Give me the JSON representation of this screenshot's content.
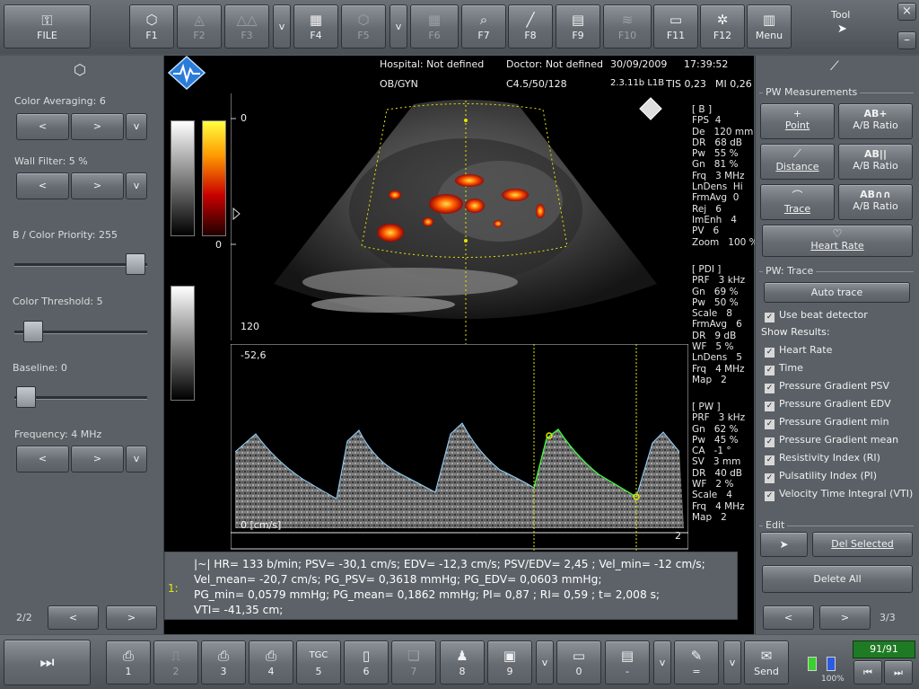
{
  "topbar": {
    "file_label": "FILE",
    "keys": [
      {
        "label": "F1",
        "icon": "⬡"
      },
      {
        "label": "F2",
        "icon": "◬"
      },
      {
        "label": "F3",
        "icon": "△△"
      },
      {
        "label": "v",
        "icon": ""
      },
      {
        "label": "F4",
        "icon": "▦"
      },
      {
        "label": "F5",
        "icon": "⬡"
      },
      {
        "label": "v",
        "icon": ""
      },
      {
        "label": "F6",
        "icon": "▦"
      },
      {
        "label": "F7",
        "icon": "⌕"
      },
      {
        "label": "F8",
        "icon": "╱"
      },
      {
        "label": "F9",
        "icon": "▤"
      },
      {
        "label": "F10",
        "icon": "≋"
      },
      {
        "label": "F11",
        "icon": "▭"
      },
      {
        "label": "F12",
        "icon": "✲"
      },
      {
        "label": "Menu",
        "icon": "▥"
      }
    ],
    "tool_label": "Tool",
    "close_label": "×",
    "minimize_label": "–"
  },
  "left_panel": {
    "color_averaging": "Color Averaging: 6",
    "wall_filter": "Wall Filter: 5 %",
    "color_priority": "B / Color Priority: 255",
    "color_threshold": "Color Threshold: 5",
    "baseline": "Baseline: 0",
    "frequency": "Frequency: 4 MHz",
    "left_arrow": "<",
    "right_arrow": ">",
    "dropdown": "v",
    "page": "2/2"
  },
  "header": {
    "hospital": "Hospital: Not defined",
    "doctor": "Doctor: Not defined",
    "date": "30/09/2009",
    "time": "17:39:52",
    "preset": "OB/GYN",
    "probe": "C4.5/50/128",
    "version": "2.3.11b L1B",
    "tis": "TIS 0,23",
    "mi": "MI 0,26"
  },
  "scale": {
    "top": "0",
    "bottom": "120",
    "color_zero": "0",
    "doppler_top": "-52,6",
    "doppler_zero": "0 [cm/s]",
    "doppler_right": "2"
  },
  "params": {
    "b_mode": "[ B ]\nFPS  4\nDe   120 mm\nDR   68 dB\nPw   55 %\nGn   81 %\nFrq   3 MHz\nLnDens  Hi\nFrmAvg  0\nRej   6\nImEnh   4\nPV   6\nZoom   100 %",
    "pdi": "[ PDI ]\nPRF   3 kHz\nGn   69 %\nPw   50 %\nScale   8\nFrmAvg   6\nDR   9 dB\nWF   5 %\nLnDens   5\nFrq   4 MHz\nMap   2",
    "pw": "[ PW ]\nPRF   3 kHz\nGn   62 %\nPw   45 %\nCA   -1 °\nSV   3 mm\nDR   40 dB\nWF   2 %\nScale   4\nFrq   4 MHz\nMap   2"
  },
  "results": {
    "index": "1:",
    "line1": "|~| HR= 133 b/min; PSV= -30,1 cm/s; EDV= -12,3 cm/s; PSV/EDV= 2,45 ; Vel_min= -12 cm/s;",
    "line2": "Vel_mean= -20,7 cm/s; PG_PSV= 0,3618 mmHg; PG_EDV= 0,0603 mmHg;",
    "line3": "PG_min= 0,0579 mmHg; PG_mean= 0,1862 mmHg; PI= 0,87 ; RI= 0,59 ; t= 2,008 s;",
    "line4": "VTI= -41,35 cm;"
  },
  "right_panel": {
    "pw_measurements_title": "PW Measurements",
    "point": "Point",
    "ab_ratio_1": "A/B Ratio",
    "distance": "Distance",
    "ab_ratio_2": "A/B Ratio",
    "trace": "Trace",
    "ab_ratio_3": "A/B Ratio",
    "heart_rate": "Heart Rate",
    "ab_icon": "AB",
    "pw_trace_title": "PW: Trace",
    "auto_trace": "Auto trace",
    "use_beat_detector": "Use beat detector",
    "show_results": "Show Results:",
    "checks": [
      "Heart Rate",
      "Time",
      "Pressure Gradient PSV",
      "Pressure Gradient EDV",
      "Pressure Gradient min",
      "Pressure Gradient mean",
      "Resistivity Index (RI)",
      "Pulsatility Index (PI)",
      "Velocity Time Integral (VTI)"
    ],
    "edit_title": "Edit",
    "del_selected": "Del Selected",
    "delete_all": "Delete All",
    "page": "3/3",
    "left_arrow": "<",
    "right_arrow": ">"
  },
  "bottombar": {
    "keys": [
      {
        "label": "1",
        "icon": "⎙"
      },
      {
        "label": "2",
        "icon": "⎍"
      },
      {
        "label": "3",
        "icon": "⎙"
      },
      {
        "label": "4",
        "icon": "⎙"
      },
      {
        "label": "5",
        "icon": "TGC"
      },
      {
        "label": "6",
        "icon": "▯"
      },
      {
        "label": "7",
        "icon": "❏"
      },
      {
        "label": "8",
        "icon": "♟"
      },
      {
        "label": "9",
        "icon": "▣"
      },
      {
        "label": "v",
        "icon": ""
      },
      {
        "label": "0",
        "icon": "▭"
      },
      {
        "label": "-",
        "icon": "▤"
      },
      {
        "label": "v",
        "icon": ""
      },
      {
        "label": "=",
        "icon": "✎"
      },
      {
        "label": "v",
        "icon": ""
      },
      {
        "label": "Send",
        "icon": "✉"
      }
    ],
    "frame_counter": "91/91",
    "battery": "100%",
    "colors": {
      "counter_bg": "#1f7a24",
      "battery_green": "#3ccf2e",
      "battery_blue": "#2a5be0"
    }
  }
}
